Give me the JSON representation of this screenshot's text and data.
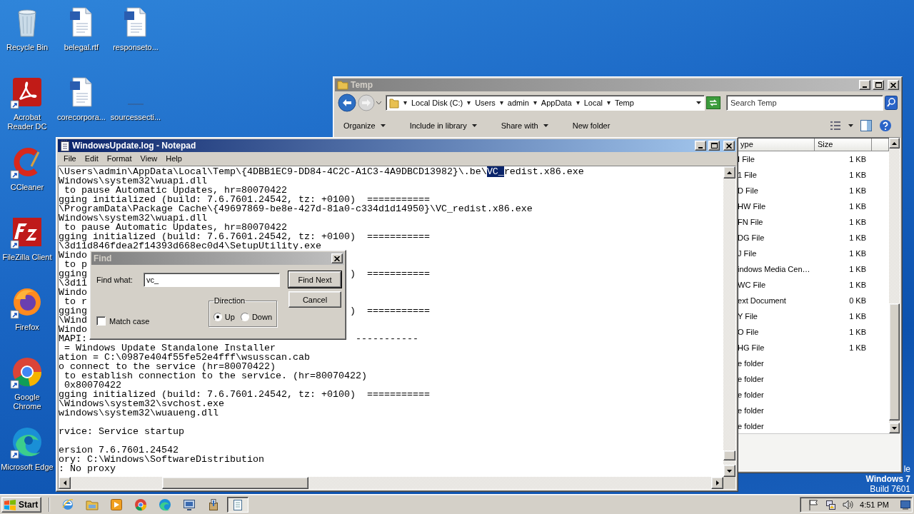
{
  "desktop": {
    "icons": [
      {
        "label": "Recycle Bin",
        "kind": "recycle",
        "shortcut": false
      },
      {
        "label": "belegal.rtf",
        "kind": "document",
        "shortcut": false
      },
      {
        "label": "responseto...",
        "kind": "document",
        "shortcut": false
      },
      {
        "label": "Acrobat Reader DC",
        "kind": "acrobat",
        "shortcut": true
      },
      {
        "label": "corecorpora...",
        "kind": "document",
        "shortcut": false
      },
      {
        "label": "sourcessecti...",
        "kind": "blank"
      },
      {
        "label": "CCleaner",
        "kind": "ccleaner",
        "shortcut": true
      },
      {
        "label": "FileZilla Client",
        "kind": "filezilla",
        "shortcut": true
      },
      {
        "label": "Firefox",
        "kind": "firefox",
        "shortcut": true
      },
      {
        "label": "Google Chrome",
        "kind": "chrome",
        "shortcut": true
      },
      {
        "label": "Microsoft Edge",
        "kind": "edge",
        "shortcut": true
      }
    ],
    "version_lines": [
      {
        "text": "le",
        "bold": false
      },
      {
        "text": "Windows 7",
        "bold": true
      },
      {
        "text": "Build 7601",
        "bold": false
      }
    ]
  },
  "explorer": {
    "title": "Temp",
    "active": false,
    "breadcrumb": [
      "Local Disk (C:)",
      "Users",
      "admin",
      "AppData",
      "Local",
      "Temp"
    ],
    "search": {
      "placeholder": "Search Temp"
    },
    "toolbar": [
      {
        "label": "Organize",
        "dropdown": true
      },
      {
        "label": "Include in library",
        "dropdown": true
      },
      {
        "label": "Share with",
        "dropdown": true
      },
      {
        "label": "New folder",
        "dropdown": false
      }
    ],
    "columns": [
      "ype",
      "Size"
    ],
    "rows": [
      {
        "type": "I File",
        "size": "1 KB"
      },
      {
        "type": "1 File",
        "size": "1 KB"
      },
      {
        "type": "D File",
        "size": "1 KB"
      },
      {
        "type": "HW File",
        "size": "1 KB"
      },
      {
        "type": "FN File",
        "size": "1 KB"
      },
      {
        "type": "DG File",
        "size": "1 KB"
      },
      {
        "type": "J File",
        "size": "1 KB"
      },
      {
        "type": "indows Media Cen…",
        "size": "1 KB"
      },
      {
        "type": "WC File",
        "size": "1 KB"
      },
      {
        "type": "ext Document",
        "size": "0 KB"
      },
      {
        "type": "Y File",
        "size": "1 KB"
      },
      {
        "type": "O File",
        "size": "1 KB"
      },
      {
        "type": "HG File",
        "size": "1 KB"
      },
      {
        "type": "e folder"
      },
      {
        "type": "e folder"
      },
      {
        "type": "e folder"
      },
      {
        "type": "e folder"
      },
      {
        "type": "e folder"
      }
    ]
  },
  "notepad": {
    "title": "WindowsUpdate.log - Notepad",
    "active": true,
    "menu": [
      "File",
      "Edit",
      "Format",
      "View",
      "Help"
    ],
    "lines": [
      {
        "kind": "match",
        "text": "\\Users\\admin\\AppData\\Local\\Temp\\{4DBB1EC9-DD84-4C2C-A1C3-4A9DBCD13982}\\.be\\",
        "match": "VC_",
        "selected": true,
        "after": "redist.x86.exe"
      },
      {
        "kind": "text",
        "text": "Windows\\system32\\wuapi.dll"
      },
      {
        "kind": "text",
        "text": " to pause Automatic Updates, hr=80070422"
      },
      {
        "kind": "text",
        "text": "gging initialized (build: 7.6.7601.24542, tz: +0100)  ==========="
      },
      {
        "kind": "text",
        "text": "\\ProgramData\\Package Cache\\{49697869-be8e-427d-81a0-c334d1d14950}\\VC_redist.x86.exe"
      },
      {
        "kind": "text",
        "text": "Windows\\system32\\wuapi.dll"
      },
      {
        "kind": "text",
        "text": " to pause Automatic Updates, hr=80070422"
      },
      {
        "kind": "text",
        "text": "gging initialized (build: 7.6.7601.24542, tz: +0100)  ==========="
      },
      {
        "kind": "text",
        "text": "\\3d11d846fdea2f14393d668ec0d4\\SetupUtility.exe"
      },
      {
        "kind": "covered",
        "text": "Windo"
      },
      {
        "kind": "covered",
        "text": " to p"
      },
      {
        "kind": "covered",
        "text": "gging",
        "tail": ")  ==========="
      },
      {
        "kind": "covered",
        "text": "\\3d11"
      },
      {
        "kind": "covered",
        "text": "Windo"
      },
      {
        "kind": "covered",
        "text": " to r"
      },
      {
        "kind": "covered",
        "text": "gging",
        "tail": ")  ==========="
      },
      {
        "kind": "covered",
        "text": "\\Wind"
      },
      {
        "kind": "covered",
        "text": "Windo"
      },
      {
        "kind": "covered",
        "text": "MAPI:",
        "tail": " -----------"
      },
      {
        "kind": "text",
        "text": " = Windows Update Standalone Installer"
      },
      {
        "kind": "text",
        "text": "ation = C:\\0987e404f55fe52e4fff\\wsusscan.cab"
      },
      {
        "kind": "text",
        "text": "o connect to the service (hr=80070422)"
      },
      {
        "kind": "text",
        "text": " to establish connection to the service. (hr=80070422)"
      },
      {
        "kind": "text",
        "text": " 0x80070422"
      },
      {
        "kind": "text",
        "text": "gging initialized (build: 7.6.7601.24542, tz: +0100)  ==========="
      },
      {
        "kind": "text",
        "text": "\\Windows\\system32\\svchost.exe"
      },
      {
        "kind": "text",
        "text": "windows\\system32\\wuaueng.dll"
      },
      {
        "kind": "blank"
      },
      {
        "kind": "text",
        "text": "rvice: Service startup"
      },
      {
        "kind": "blank"
      },
      {
        "kind": "text",
        "text": "ersion 7.6.7601.24542"
      },
      {
        "kind": "text",
        "text": "ory: C:\\Windows\\SoftwareDistribution"
      },
      {
        "kind": "text",
        "text": ": No proxy"
      }
    ]
  },
  "find_dialog": {
    "title": "Find",
    "active": false,
    "find_what_label": "Find what:",
    "find_what_value": "vc_",
    "match_case": {
      "label": "Match case",
      "checked": false
    },
    "direction": {
      "label": "Direction",
      "options": [
        {
          "label": "Up",
          "selected": true
        },
        {
          "label": "Down",
          "selected": false
        }
      ]
    },
    "buttons": [
      {
        "label": "Find Next",
        "default": true
      },
      {
        "label": "Cancel",
        "default": false
      }
    ]
  },
  "taskbar": {
    "start": "Start",
    "apps": [
      {
        "kind": "ie",
        "pressed": false
      },
      {
        "kind": "folder",
        "pressed": false
      },
      {
        "kind": "media",
        "pressed": false
      },
      {
        "kind": "chrome",
        "pressed": false
      },
      {
        "kind": "edge",
        "pressed": false
      },
      {
        "kind": "monitor",
        "pressed": false
      },
      {
        "kind": "setup",
        "pressed": false
      },
      {
        "kind": "notepad",
        "pressed": true
      }
    ],
    "clock": "4:51 PM"
  }
}
